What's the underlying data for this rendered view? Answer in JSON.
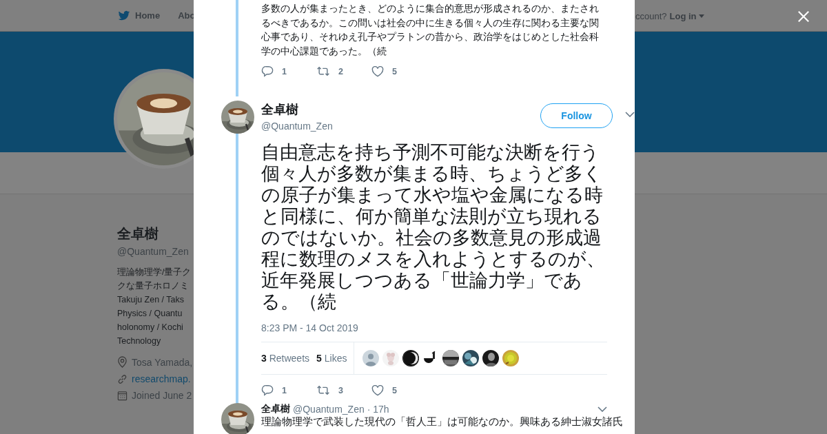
{
  "background_page": {
    "nav": [
      {
        "label": "Home"
      },
      {
        "label": "Abo"
      }
    ],
    "account_prompt": "ccount?",
    "login": "Log in",
    "profile": {
      "name": "全卓樹",
      "handle": "@Quantum_Zen",
      "bio": [
        "理論物理学/量子ク",
        "クな量子ホロノミ",
        "Takuju Zen / Taks",
        "Physics / Quantu",
        "holonomy / Kochi",
        "Technology"
      ],
      "location": "Tosa Yamada,",
      "website": "researchmap.",
      "joined": "Joined June 2"
    }
  },
  "thread": [
    {
      "kind": "context",
      "text": "多数の人が集まったとき、どのように集合的意思が形成されるのか、またされるべきであるか。この問いは社会の中に生きる個々人の生存に関わる主要な関心事であり、それゆえ孔子やプラトンの昔から、政治学をはじめとした社会科学の中心課題であった。（続",
      "actions": {
        "replies": "1",
        "retweets": "2",
        "likes": "5"
      }
    },
    {
      "kind": "focused",
      "name": "全卓樹",
      "handle": "@Quantum_Zen",
      "follow": "Follow",
      "text": "自由意志を持ち予測不可能な決断を行う個々人が多数が集まる時、ちょうど多くの原子が集まって水や塩や金属になる時と同様に、何か簡単な法則が立ち現れるのではないか。社会の多数意見の形成過程に数理のメスを入れようとするのが、近年発展しつつある「世論力学」である。（続",
      "timestamp": "8:23 PM - 14 Oct 2019",
      "retweet_count": "3",
      "retweet_label": "Retweets",
      "like_count": "5",
      "like_label": "Likes",
      "likers": [
        {
          "kind": "default"
        },
        {
          "kind": "picture"
        },
        {
          "kind": "picture"
        },
        {
          "kind": "picture"
        },
        {
          "kind": "picture"
        },
        {
          "kind": "picture"
        },
        {
          "kind": "picture"
        },
        {
          "kind": "picture"
        }
      ],
      "actions": {
        "replies": "1",
        "retweets": "3",
        "likes": "5"
      }
    },
    {
      "kind": "reply",
      "name": "全卓樹",
      "handle": "@Quantum_Zen",
      "time": "· 17h",
      "text": "理論物理学で武装した現代の「哲人王」は可能なのか。興味ある紳士淑女諸氏"
    }
  ]
}
